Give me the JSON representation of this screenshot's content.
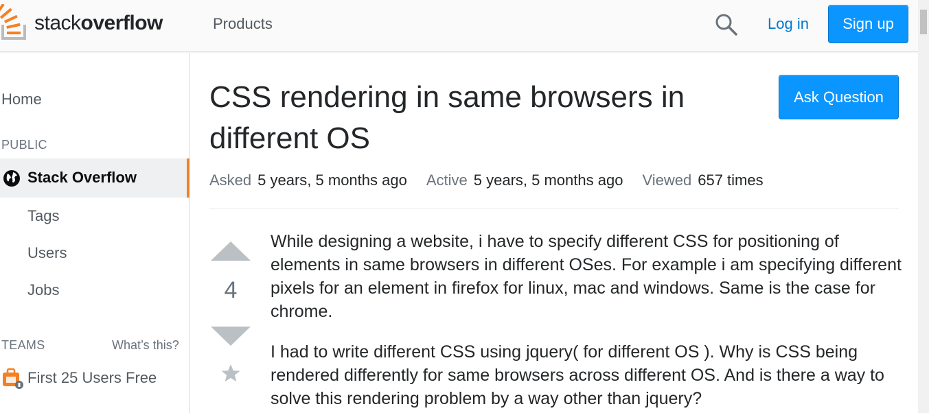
{
  "header": {
    "logo_light": "stack",
    "logo_bold": "overflow",
    "products_label": "Products",
    "login_label": "Log in",
    "signup_label": "Sign up",
    "accent_color": "#0a95ff",
    "brand_color": "#f48024"
  },
  "sidebar": {
    "home": "Home",
    "public_heading": "PUBLIC",
    "stack_overflow": "Stack Overflow",
    "tags": "Tags",
    "users": "Users",
    "jobs": "Jobs",
    "teams_heading": "TEAMS",
    "whats_this": "What’s this?",
    "teams_item": "First 25 Users Free"
  },
  "question": {
    "title": "CSS rendering in same browsers in different OS",
    "ask_button": "Ask Question",
    "meta": {
      "asked_label": "Asked",
      "asked_value": "5 years, 5 months ago",
      "active_label": "Active",
      "active_value": "5 years, 5 months ago",
      "viewed_label": "Viewed",
      "viewed_value": "657 times"
    },
    "votes": "4",
    "body": [
      "While designing a website, i have to specify different CSS for positioning of elements in same browsers in different OSes. For example i am specifying different pixels for an element in firefox for linux, mac and windows. Same is the case for chrome.",
      "I had to write different CSS using jquery( for different OS ). Why is CSS being rendered differently for same browsers across different OS. And is there a way to solve this rendering problem by a way other than jquery?"
    ]
  }
}
